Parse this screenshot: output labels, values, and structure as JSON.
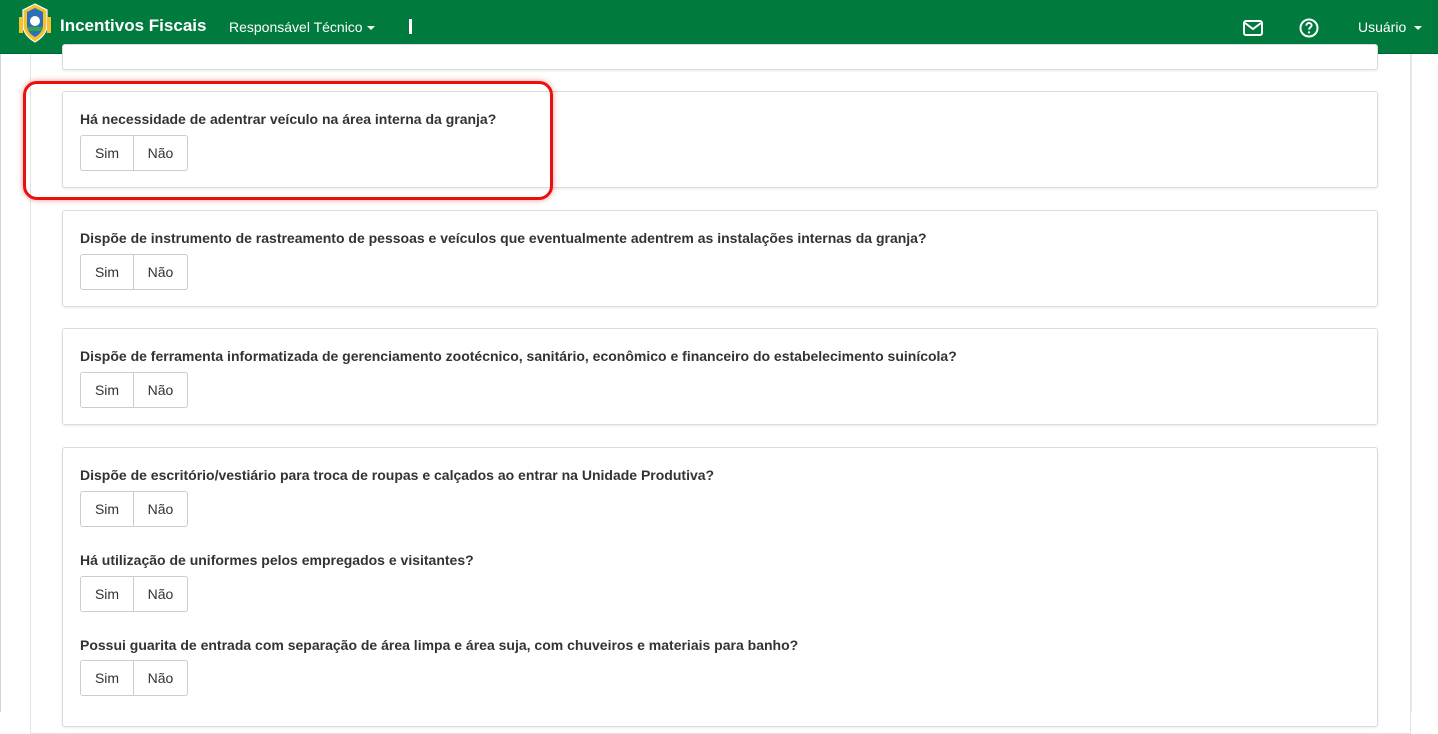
{
  "navbar": {
    "brand": "Incentivos Fiscais",
    "menu_label": "Responsável Técnico",
    "user_label": "Usuário",
    "icons": [
      "coat-of-arms-icon",
      "envelope-icon",
      "question-circle-icon",
      "caret-down-icon"
    ],
    "bg_color": "#007a3d"
  },
  "cards": [
    {
      "questions": [
        {
          "text": "Há necessidade de adentrar veículo na área interna da granja?",
          "yes": "Sim",
          "no": "Não"
        }
      ]
    },
    {
      "questions": [
        {
          "text": "Dispõe de instrumento de rastreamento de pessoas e veículos que eventualmente adentrem as instalações internas da granja?",
          "yes": "Sim",
          "no": "Não"
        }
      ]
    },
    {
      "questions": [
        {
          "text": "Dispõe de ferramenta informatizada de gerenciamento zootécnico, sanitário, econômico e financeiro do estabelecimento suinícola?",
          "yes": "Sim",
          "no": "Não"
        }
      ]
    },
    {
      "questions": [
        {
          "text": "Dispõe de escritório/vestiário para troca de roupas e calçados ao entrar na Unidade Produtiva?",
          "yes": "Sim",
          "no": "Não"
        },
        {
          "text": "Há utilização de uniformes pelos empregados e visitantes?",
          "yes": "Sim",
          "no": "Não"
        },
        {
          "text": "Possui guarita de entrada com separação de área limpa e área suja, com chuveiros e materiais para banho?",
          "yes": "Sim",
          "no": "Não"
        }
      ]
    }
  ],
  "highlight_color": "#e8120c"
}
